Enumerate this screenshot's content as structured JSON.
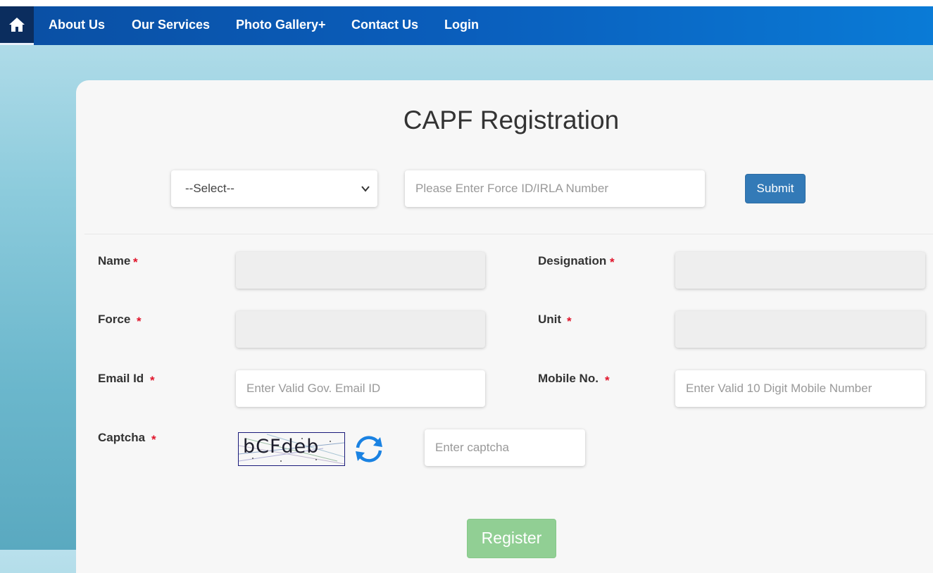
{
  "nav": {
    "home_icon": "home-icon",
    "items": [
      {
        "label": "About Us"
      },
      {
        "label": "Our Services"
      },
      {
        "label": "Photo Gallery+"
      },
      {
        "label": "Contact Us"
      },
      {
        "label": "Login"
      }
    ]
  },
  "page": {
    "title": "CAPF Registration"
  },
  "lookup": {
    "select_value": "--Select--",
    "force_id_placeholder": "Please Enter Force ID/IRLA Number",
    "submit_label": "Submit"
  },
  "form": {
    "name_label": "Name",
    "designation_label": "Designation",
    "force_label": "Force",
    "unit_label": "Unit",
    "email_label": "Email Id",
    "email_placeholder": "Enter Valid Gov. Email ID",
    "mobile_label": "Mobile No.",
    "mobile_placeholder": "Enter Valid 10 Digit Mobile Number",
    "captcha_label": "Captcha",
    "captcha_text": "bCFdeb",
    "captcha_placeholder": "Enter captcha",
    "required_mark": "*",
    "register_label": "Register"
  },
  "colors": {
    "nav_start": "#0a4fa3",
    "nav_end": "#0a7bd6",
    "submit": "#337ab7",
    "register": "#91cf94",
    "required": "#e0142a",
    "refresh_icon": "#1a82e2"
  }
}
